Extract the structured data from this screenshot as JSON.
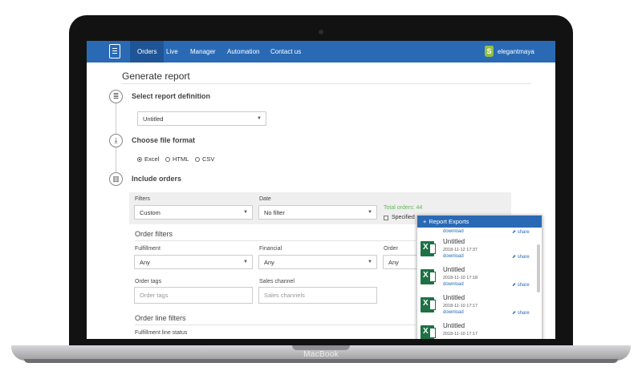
{
  "device": {
    "brand": "MacBook"
  },
  "nav": {
    "items": [
      {
        "label": "Orders",
        "active": true
      },
      {
        "label": "Live"
      },
      {
        "label": "Manager"
      },
      {
        "label": "Automation"
      },
      {
        "label": "Contact us"
      }
    ],
    "shop_name": "elegantmaya",
    "shop_icon_letter": "S",
    "color": "#2a6ab5"
  },
  "page": {
    "title": "Generate report"
  },
  "steps": [
    {
      "label": "Select report definition",
      "icon": "clipboard-icon"
    },
    {
      "label": "Choose file format",
      "icon": "download-icon"
    },
    {
      "label": "Include orders",
      "icon": "columns-icon"
    }
  ],
  "report_definition": {
    "selected": "Untitled"
  },
  "file_format": {
    "options": [
      "Excel",
      "HTML",
      "CSV"
    ],
    "selected": "Excel"
  },
  "filters": {
    "filters_label": "Filters",
    "filters_value": "Custom",
    "date_label": "Date",
    "date_value": "No filter",
    "total_orders": "Total orders: 44",
    "specified_label": "Specified"
  },
  "order_filters": {
    "title": "Order filters",
    "fulfillment_label": "Fulfillment",
    "fulfillment_value": "Any",
    "financial_label": "Financial",
    "financial_value": "Any",
    "order_label": "Order",
    "order_value": "Any",
    "tags_label": "Order tags",
    "tags_placeholder": "Order tags",
    "channel_label": "Sales channel",
    "channel_placeholder": "Sales channels"
  },
  "order_line_filters": {
    "title": "Order line filters",
    "fulfillment_line_label": "Fulfillment line status"
  },
  "exports": {
    "title": "Report Exports",
    "download_label": "download",
    "share_label": "share",
    "items": [
      {
        "name": "Untitled",
        "date": "2018-11-12 17:37"
      },
      {
        "name": "Untitled",
        "date": "2018-11-10 17:18"
      },
      {
        "name": "Untitled",
        "date": "2018-11-10 17:17"
      },
      {
        "name": "Untitled",
        "date": "2018-11-10 17:17"
      }
    ]
  }
}
